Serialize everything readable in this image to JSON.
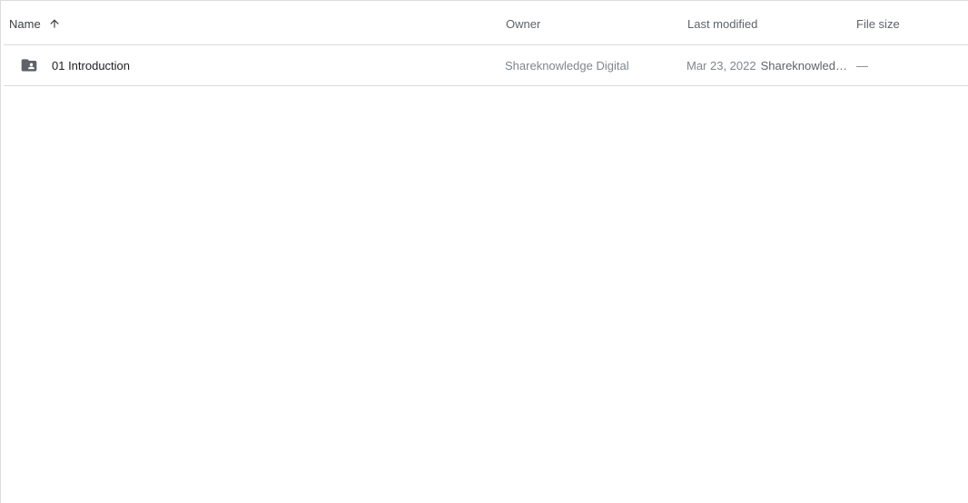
{
  "columns": {
    "name": "Name",
    "owner": "Owner",
    "last_modified": "Last modified",
    "file_size": "File size"
  },
  "sort": {
    "column": "name",
    "direction": "ascending",
    "icon": "arrow-up-icon"
  },
  "rows": [
    {
      "icon": "shared-folder-icon",
      "name": "01 Introduction",
      "owner": "Shareknowledge Digital",
      "modified_date": "Mar 23, 2022",
      "modified_by": "Shareknowledge Digital",
      "file_size": "—"
    }
  ],
  "colors": {
    "border": "#dadce0",
    "icon": "#5f6368",
    "primary_text": "#202124",
    "secondary_text": "#80868b"
  }
}
